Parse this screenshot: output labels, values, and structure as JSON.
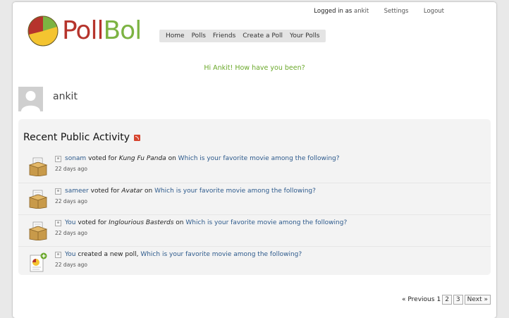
{
  "header": {
    "logged_in_prefix": "Logged in as",
    "username": "ankit",
    "settings": "Settings",
    "logout": "Logout"
  },
  "logo": {
    "part1": "Poll",
    "part2": "Bol"
  },
  "nav": {
    "items": [
      "Home",
      "Polls",
      "Friends",
      "Create a Poll",
      "Your Polls"
    ]
  },
  "greeting": "Hi Ankit! How have you been?",
  "profile": {
    "name": "ankit"
  },
  "activity": {
    "title": "Recent Public Activity",
    "items": [
      {
        "user": "sonam",
        "verb": "voted for",
        "choice": "Kung Fu Panda",
        "on": "on",
        "poll": "Which is your favorite movie among the following?",
        "time": "22 days ago"
      },
      {
        "user": "sameer",
        "verb": "voted for",
        "choice": "Avatar",
        "on": "on",
        "poll": "Which is your favorite movie among the following?",
        "time": "22 days ago"
      },
      {
        "user": "You",
        "verb": "voted for",
        "choice": "Inglourious Basterds",
        "on": "on",
        "poll": "Which is your favorite movie among the following?",
        "time": "22 days ago"
      },
      {
        "user": "You",
        "verb": "created a new poll,",
        "poll": "Which is your favorite movie among the following?",
        "time": "22 days ago"
      }
    ]
  },
  "pagination": {
    "previous": "« Previous",
    "current": "1",
    "pages": [
      "2",
      "3"
    ],
    "next": "Next »"
  }
}
